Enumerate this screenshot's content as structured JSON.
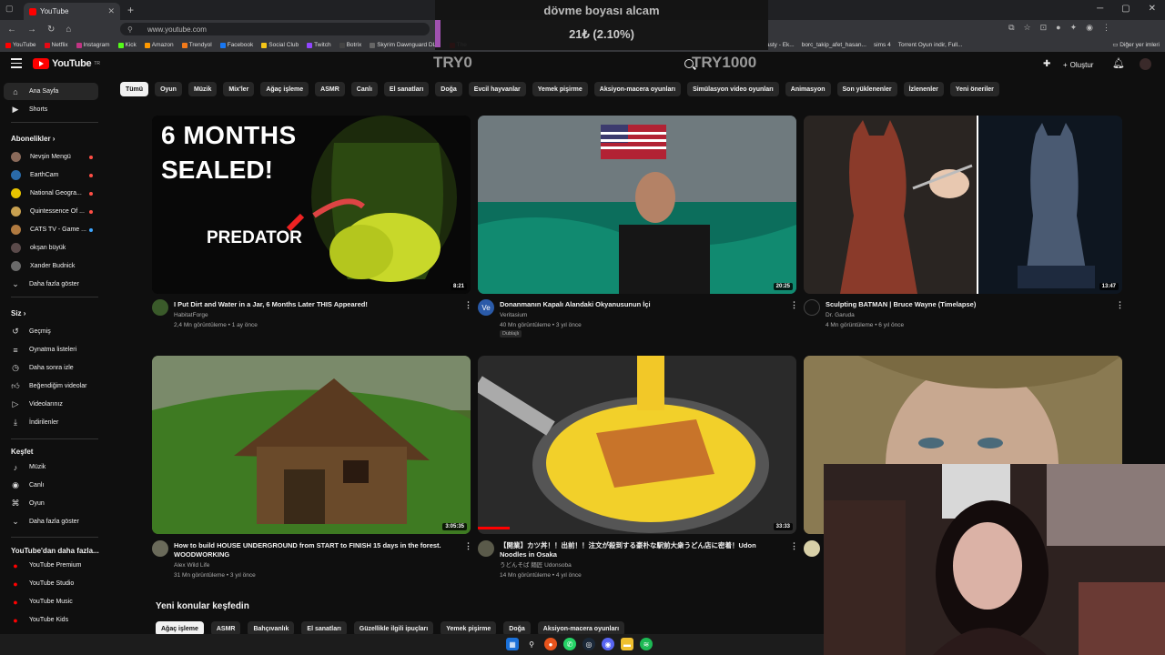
{
  "browser": {
    "tab_title": "YouTube",
    "url": "www.youtube.com",
    "bookmarks": [
      "YouTube",
      "Netflix",
      "Instagram",
      "Kick",
      "Amazon",
      "Trendyol",
      "Facebook",
      "Social Club",
      "Twitch",
      "Botrix",
      "Skyrim Dawnguard DL...",
      "The"
    ],
    "bookmarks_right": [
      "asty - Ek...",
      "borc_takip_afet_hasan...",
      "sims 4",
      "Torrent Oyun indir, Full..."
    ],
    "other_bookmarks": "Diğer yer imleri"
  },
  "overlay": {
    "title": "dövme boyası alcam",
    "progress_text": "21₺ (2.10%)",
    "min_label": "TRY0",
    "max_label": "TRY1000"
  },
  "header": {
    "logo_text": "YouTube",
    "logo_sup": "TR",
    "create_label": "Oluştur"
  },
  "chips": [
    "Tümü",
    "Oyun",
    "Müzik",
    "Mix'ler",
    "Ağaç işleme",
    "ASMR",
    "Canlı",
    "El sanatları",
    "Doğa",
    "Evcil hayvanlar",
    "Yemek pişirme",
    "Aksiyon-macera oyunları",
    "Simülasyon video oyunları",
    "Animasyon",
    "Son yüklenenler",
    "İzlenenler",
    "Yeni öneriler"
  ],
  "sidebar": {
    "home": "Ana Sayfa",
    "shorts": "Shorts",
    "subs_header": "Abonelikler",
    "subs": [
      {
        "name": "Nevşin Mengü",
        "color": "#8a6a5a",
        "live": true
      },
      {
        "name": "EarthCam",
        "color": "#2a6aa8",
        "live": true
      },
      {
        "name": "National Geogra...",
        "color": "#e8c400",
        "live": true
      },
      {
        "name": "Quintessence Of ...",
        "color": "#c8a050",
        "live": true
      },
      {
        "name": "CATS TV - Game ...",
        "color": "#b07a40",
        "live": false,
        "dot": true
      },
      {
        "name": "okşan büyük",
        "color": "#5a4a4a",
        "live": false
      },
      {
        "name": "Xander Budnick",
        "color": "#6a6a6a",
        "live": false
      }
    ],
    "show_more": "Daha fazla göster",
    "you_header": "Siz",
    "you_items": [
      "Geçmiş",
      "Oynatma listeleri",
      "Daha sonra izle",
      "Beğendiğim videolar",
      "Videolarınız",
      "İndirilenler"
    ],
    "explore_header": "Keşfet",
    "explore_items": [
      "Müzik",
      "Canlı",
      "Oyun"
    ],
    "explore_more": "Daha fazla göster",
    "more_header": "YouTube'dan daha fazla...",
    "more_items": [
      "YouTube Premium",
      "YouTube Studio",
      "YouTube Music",
      "YouTube Kids"
    ]
  },
  "videos": [
    {
      "title": "I Put Dirt and Water in a Jar, 6 Months Later THIS Appeared!",
      "channel": "HabitatForge",
      "meta": "2,4 Mn görüntüleme • 1 ay önce",
      "duration": "8:21",
      "thumb_text1": "6 MONTHS",
      "thumb_text2": "SEALED!",
      "thumb_text3": "PREDATOR"
    },
    {
      "title": "Donanmanın Kapalı Alandaki Okyanusunun İçi",
      "channel": "Veritasium",
      "meta": "40 Mn görüntüleme • 3 yıl önce",
      "duration": "20:25",
      "badge": "Dublajlı",
      "avatar_text": "Ve"
    },
    {
      "title": "Sculpting BATMAN | Bruce Wayne (Timelapse)",
      "channel": "Dr. Garuda",
      "meta": "4 Mn görüntüleme • 6 yıl önce",
      "duration": "13:47"
    },
    {
      "title": "How to build HOUSE UNDERGROUND from START to FINISH 15 days in the forest. WOODWORKING",
      "channel": "Alex Wild Life",
      "meta": "31 Mn görüntüleme • 3 yıl önce",
      "duration": "3:05:35"
    },
    {
      "title": "【開業】カツ丼！！出前！！注文が殺到する豪朴な駅前大衆うどん店に密着！Udon Noodles in Osaka",
      "channel": "うどんそば 麺匠 Udonsoba",
      "meta": "14 Mn görüntüleme • 4 yıl önce",
      "duration": "33:33"
    },
    {
      "title": "",
      "channel": "",
      "meta": "",
      "duration": ""
    }
  ],
  "explore_section": {
    "title": "Yeni konular keşfedin",
    "chips": [
      "Ağaç işleme",
      "ASMR",
      "Bahçıvanlık",
      "El sanatları",
      "Güzellikle ilgili ipuçları",
      "Yemek pişirme",
      "Doğa",
      "Aksiyon-macera oyunları"
    ]
  },
  "colors": {
    "bg": "#0f0f0f",
    "chip": "#272727",
    "brand_red": "#ff0000",
    "overlay_accent": "#a052b0"
  }
}
